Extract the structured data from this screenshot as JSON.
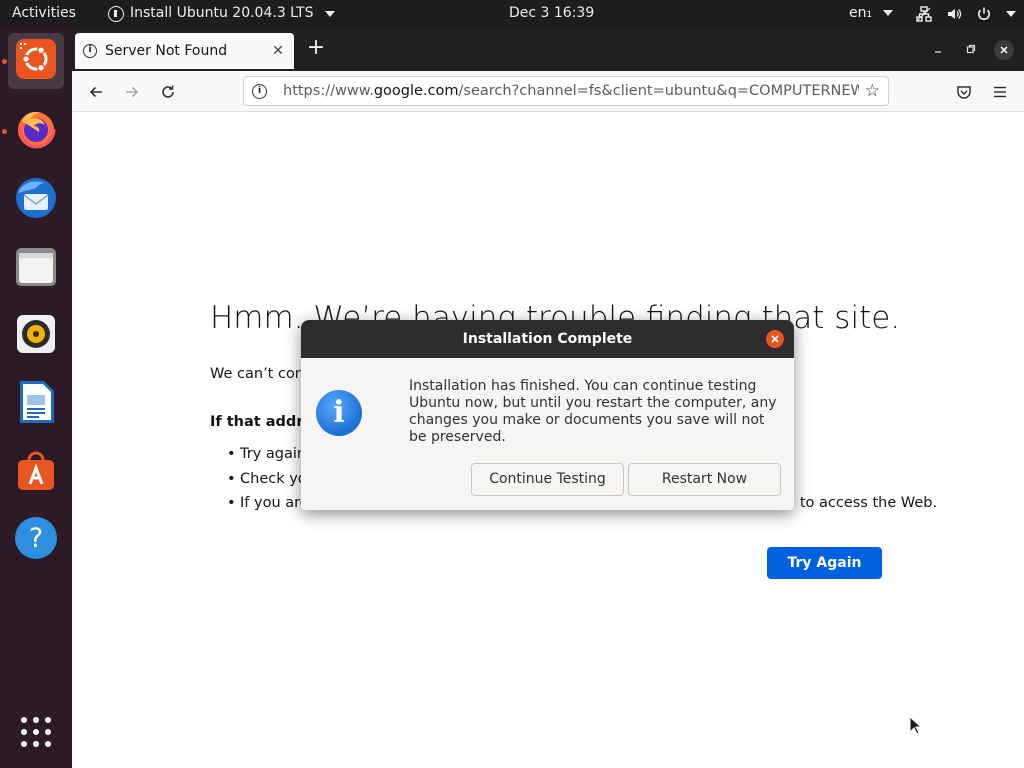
{
  "topbar": {
    "activities": "Activities",
    "app_menu": "Install Ubuntu 20.04.3 LTS",
    "clock": "Dec 3  16:39",
    "language": "en₁"
  },
  "dock": {
    "items": [
      "ubuntu-installer",
      "firefox",
      "thunderbird",
      "files",
      "rhythmbox",
      "libreoffice-writer",
      "ubuntu-software",
      "help",
      "show-applications"
    ]
  },
  "browser": {
    "tab_title": "Server Not Found",
    "url_prefix": "https://www.",
    "url_host": "google.com",
    "url_rest": "/search?channel=fs&client=ubuntu&q=COMPUTERNEWB"
  },
  "error_page": {
    "title": "Hmm. We’re having trouble finding that site.",
    "description": "We can’t connect to the server at www.google.com.",
    "subheading": "If that address is correct, here are three other things you can try:",
    "tips": [
      "Try again later.",
      "Check your network connection.",
      "If you are connected but behind a firewall, check that Firefox has permission to access the Web."
    ],
    "try_again_label": "Try Again"
  },
  "dialog": {
    "title": "Installation Complete",
    "message": "Installation has finished.  You can continue testing Ubuntu now, but until you restart the computer, any changes you make or documents you save will not be preserved.",
    "continue_label": "Continue Testing",
    "restart_label": "Restart Now"
  },
  "colors": {
    "ubuntu_orange": "#e95420",
    "dock_bg": "#2c1b27",
    "topbar_bg": "#1d1d1d",
    "firefox_blue": "#0061e0"
  }
}
